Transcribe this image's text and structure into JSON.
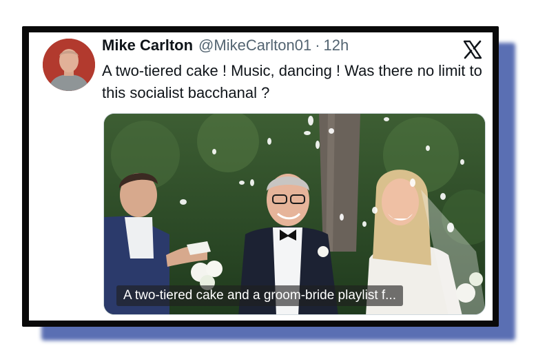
{
  "tweet": {
    "author_name": "Mike Carlton",
    "handle": "@MikeCarlton01",
    "separator": "·",
    "time": "12h",
    "text": "A two-tiered cake !  Music, dancing !  Was there no limit to this socialist bacchanal ?"
  },
  "media": {
    "caption": "A two-tiered cake and a groom-bride playlist f..."
  },
  "icons": {
    "platform": "x-logo-icon",
    "avatar": "avatar"
  },
  "colors": {
    "frame_shadow": "#5a6fb3",
    "frame": "#0a0a0a",
    "avatar_bg": "#b23a2e"
  }
}
